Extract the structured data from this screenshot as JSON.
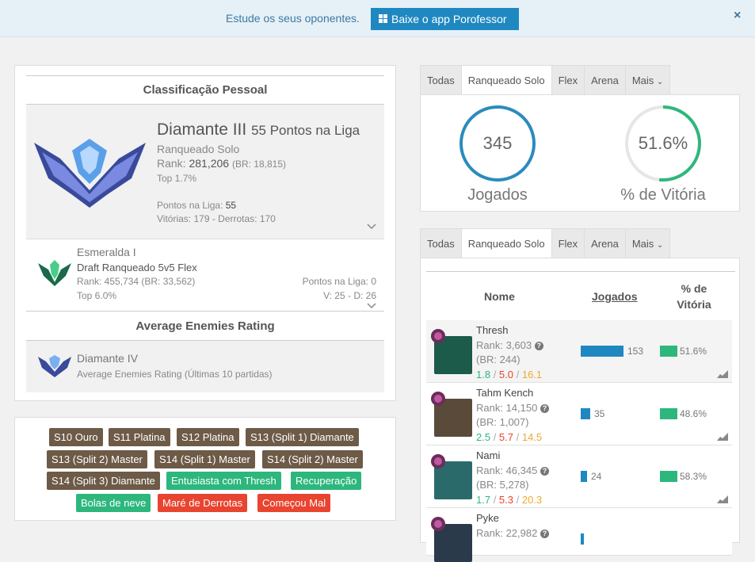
{
  "banner": {
    "text": "Estude os seus oponentes.",
    "button": "Baixe o app Porofessor",
    "close": "×"
  },
  "personal": {
    "title": "Classificação Pessoal",
    "main": {
      "tier": "Diamante III",
      "lp": "55 Pontos na Liga",
      "queue": "Ranqueado Solo",
      "rank_label": "Rank:",
      "rank_value": "281,206",
      "br": "(BR: 18,815)",
      "top": "Top 1.7%",
      "lp_label": "Pontos na Liga:",
      "lp_value": "55",
      "record": "Vitórias: 179 - Derrotas: 170"
    },
    "flex": {
      "tier": "Esmeralda I",
      "queue": "Draft Ranqueado 5v5 Flex",
      "rank": "Rank: 455,734 (BR: 33,562)",
      "top": "Top 6.0%",
      "lp": "Pontos na Liga: 0",
      "record": "V: 25 - D: 26"
    },
    "enemies_title": "Average Enemies Rating",
    "enemies": {
      "tier": "Diamante IV",
      "desc": "Average Enemies Rating (Últimas 10 partidas)"
    }
  },
  "tags": {
    "row1": [
      "S10 Ouro",
      "S11 Platina",
      "S12 Platina",
      "S13 (Split 1) Diamante"
    ],
    "row2": [
      "S13 (Split 2) Master",
      "S14 (Split 1) Master",
      "S14 (Split 2) Master"
    ],
    "row3": [
      "S14 (Split 3) Diamante",
      "Entusiasta com Thresh",
      "Recuperação"
    ],
    "row4": [
      "Bolas de neve",
      "Maré de Derrotas",
      "Começou Mal"
    ]
  },
  "tabs1": [
    "Todas",
    "Ranqueado Solo",
    "Flex",
    "Arena",
    "Mais"
  ],
  "tabs1_active": "Ranqueado Solo",
  "stats": {
    "played": "345",
    "played_label": "Jogados",
    "winrate": "51.6%",
    "winrate_label": "% de Vitória",
    "winrate_fraction": 0.516
  },
  "tabs2": [
    "Todas",
    "Ranqueado Solo",
    "Flex",
    "Arena",
    "Mais"
  ],
  "table": {
    "headers": {
      "name": "Nome",
      "played": "Jogados",
      "winrate_1": "% de",
      "winrate_2": "Vitória"
    },
    "max_games": 153,
    "rows": [
      {
        "name": "Thresh",
        "rank": "Rank: 3,603",
        "br": "(BR: 244)",
        "k": "1.8",
        "d": "5.0",
        "a": "16.1",
        "games": 153,
        "games_label": "153",
        "wr": "51.6%",
        "color": "#1c5a4a"
      },
      {
        "name": "Tahm Kench",
        "rank": "Rank: 14,150",
        "br": "(BR: 1,007)",
        "k": "2.5",
        "d": "5.7",
        "a": "14.5",
        "games": 35,
        "games_label": "35",
        "wr": "48.6%",
        "color": "#5a4a3a"
      },
      {
        "name": "Nami",
        "rank": "Rank: 46,345",
        "br": "(BR: 5,278)",
        "k": "1.7",
        "d": "5.3",
        "a": "20.3",
        "games": 24,
        "games_label": "24",
        "wr": "58.3%",
        "color": "#2a6a6a"
      },
      {
        "name": "Pyke",
        "rank": "Rank: 22,982",
        "br": "",
        "k": "",
        "d": "",
        "a": "",
        "games": 10,
        "games_label": "",
        "wr": "",
        "color": "#2a3a4a"
      }
    ]
  },
  "colors": {
    "accent": "#1f88c1",
    "win": "#2db77d",
    "loss": "#e8442f",
    "assist": "#f0a830",
    "tag_brown": "#6d5a47"
  }
}
